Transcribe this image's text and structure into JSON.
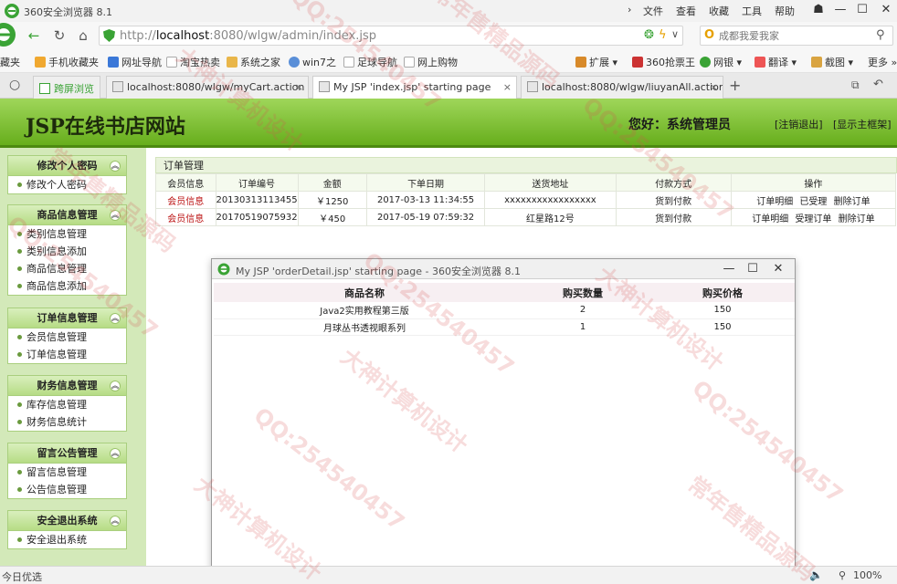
{
  "browser": {
    "app_title": "360安全浏览器 8.1",
    "menu": [
      "文件",
      "查看",
      "收藏",
      "工具",
      "帮助"
    ],
    "url_prefix": "http://",
    "url_host": "localhost",
    "url_rest": ":8080/wlgw/admin/index.jsp",
    "search_placeholder": "成都我爱我家",
    "bookmarks": [
      "藏夹",
      "手机收藏夹",
      "网址导航",
      "淘宝热卖",
      "系统之家",
      "win7之",
      "足球导航",
      "网上购物"
    ],
    "right_tools": [
      "扩展",
      "360抢票王",
      "网银",
      "翻译",
      "截图",
      "更多"
    ],
    "tabs": [
      {
        "label": "跨屏浏览"
      },
      {
        "label": "localhost:8080/wlgw/myCart.action"
      },
      {
        "label": "My JSP 'index.jsp' starting page"
      },
      {
        "label": "localhost:8080/wlgw/liuyanAll.action"
      }
    ],
    "status_left": "今日优选",
    "zoom": "100%",
    "colors": {
      "chrome_bg": "#f2f2f2",
      "accent_green": "#67ae1c"
    }
  },
  "site": {
    "title": "JSP在线书店网站",
    "greeting": "您好：系统管理员",
    "logout": "[注销退出]",
    "show_frame": "[显示主框架]"
  },
  "sidebar": [
    {
      "title": "修改个人密码",
      "items": [
        "修改个人密码"
      ]
    },
    {
      "title": "商品信息管理",
      "items": [
        "类别信息管理",
        "类别信息添加",
        "商品信息管理",
        "商品信息添加"
      ]
    },
    {
      "title": "订单信息管理",
      "items": [
        "会员信息管理",
        "订单信息管理"
      ]
    },
    {
      "title": "财务信息管理",
      "items": [
        "库存信息管理",
        "财务信息统计"
      ]
    },
    {
      "title": "留言公告管理",
      "items": [
        "留言信息管理",
        "公告信息管理"
      ]
    },
    {
      "title": "安全退出系统",
      "items": [
        "安全退出系统"
      ]
    }
  ],
  "orders": {
    "breadcrumb": "订单管理",
    "headers": [
      "会员信息",
      "订单编号",
      "金额",
      "下单日期",
      "送货地址",
      "付款方式",
      "操作"
    ],
    "rows": [
      {
        "member": "会员信息",
        "order_no": "20130313113455",
        "amount": "￥1250",
        "date": "2017-03-13 11:34:55",
        "address": "xxxxxxxxxxxxxxxxx",
        "payment": "货到付款",
        "ops": [
          "订单明细",
          "已受理",
          "删除订单"
        ]
      },
      {
        "member": "会员信息",
        "order_no": "20170519075932",
        "amount": "￥450",
        "date": "2017-05-19 07:59:32",
        "address": "红星路12号",
        "payment": "货到付款",
        "ops": [
          "订单明细",
          "受理订单",
          "删除订单"
        ]
      }
    ]
  },
  "popup": {
    "title": "My JSP 'orderDetail.jsp' starting page - 360安全浏览器 8.1",
    "headers": [
      "商品名称",
      "购买数量",
      "购买价格"
    ],
    "rows": [
      {
        "name": "Java2实用教程第三版",
        "qty": "2",
        "price": "150"
      },
      {
        "name": "月球丛书透视眼系列",
        "qty": "1",
        "price": "150"
      }
    ]
  },
  "watermarks": [
    "QQ:254540457",
    "大神计算机设计",
    "常年售精品源码"
  ]
}
